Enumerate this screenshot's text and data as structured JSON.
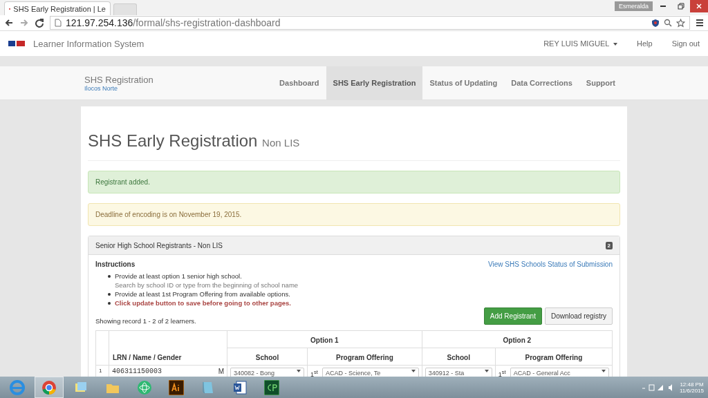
{
  "browser": {
    "tab_title": "SHS Early Registration | Le",
    "url_host": "121.97.254.136",
    "url_path": "/formal/shs-registration-dashboard",
    "profile": "Esmeralda"
  },
  "navbar": {
    "brand": "Learner Information System",
    "user": "REY LUIS MIGUEL",
    "links": [
      "Help",
      "Sign out"
    ]
  },
  "subnav": {
    "title": "SHS Registration",
    "region": "Ilocos Norte",
    "tabs": [
      {
        "label": "Dashboard",
        "selected": false
      },
      {
        "label": "SHS Early Registration",
        "selected": true
      },
      {
        "label": "Status of Updating",
        "selected": false
      },
      {
        "label": "Data Corrections",
        "selected": false
      },
      {
        "label": "Support",
        "selected": false
      }
    ]
  },
  "page": {
    "heading": "SHS Early Registration",
    "subheading": "Non LIS",
    "alerts": [
      {
        "kind": "success",
        "text": "Registrant added."
      },
      {
        "kind": "warning",
        "text": "Deadline of encoding is on November 19, 2015."
      }
    ]
  },
  "panel": {
    "title": "Senior High School Registrants - Non LIS",
    "badge": "2",
    "instructions_title": "Instructions",
    "link": "View SHS Schools Status of Submission",
    "instructions": [
      {
        "text": "Provide at least option 1 senior high school.",
        "hint": "Search by school ID or type from the beginning of school name",
        "important": false
      },
      {
        "text": "Provide at least 1st Program Offering from available options.",
        "important": false
      },
      {
        "text": "Click update button to save before going to other pages.",
        "important": true
      }
    ],
    "showing": "Showing record 1 - 2 of 2 learners.",
    "buttons": [
      {
        "label": "Add Registrant",
        "kind": "primary"
      },
      {
        "label": "Download registry",
        "kind": "default"
      }
    ]
  },
  "table": {
    "first_column": "LRN / Name / Gender",
    "options": [
      {
        "title": "Option 1",
        "columns": [
          "School",
          "Program Offering"
        ]
      },
      {
        "title": "Option 2",
        "columns": [
          "School",
          "Program Offering"
        ]
      }
    ],
    "rows": [
      {
        "index": "1",
        "lrn": "406311150003",
        "gender": "M",
        "options": [
          {
            "school": "340082 - Bong",
            "rank": "1$^{st}$",
            "program": "ACAD - Science, Te"
          },
          {
            "school": "340912 - Sta",
            "rank": "1$^{st}$",
            "program": "ACAD - General Acc"
          }
        ]
      }
    ]
  },
  "taskbar": {
    "apps": [
      {
        "kind": "ie",
        "selected": false
      },
      {
        "kind": "chrome",
        "selected": true
      },
      {
        "kind": "notes",
        "selected": false
      },
      {
        "kind": "folder",
        "selected": false
      },
      {
        "kind": "atom",
        "selected": false
      },
      {
        "kind": "illustrator",
        "selected": false
      },
      {
        "kind": "book",
        "selected": false
      },
      {
        "kind": "word",
        "selected": false
      },
      {
        "kind": "captivate",
        "selected": false
      }
    ],
    "time": "12:48 PM",
    "date": "11/6/2015"
  }
}
